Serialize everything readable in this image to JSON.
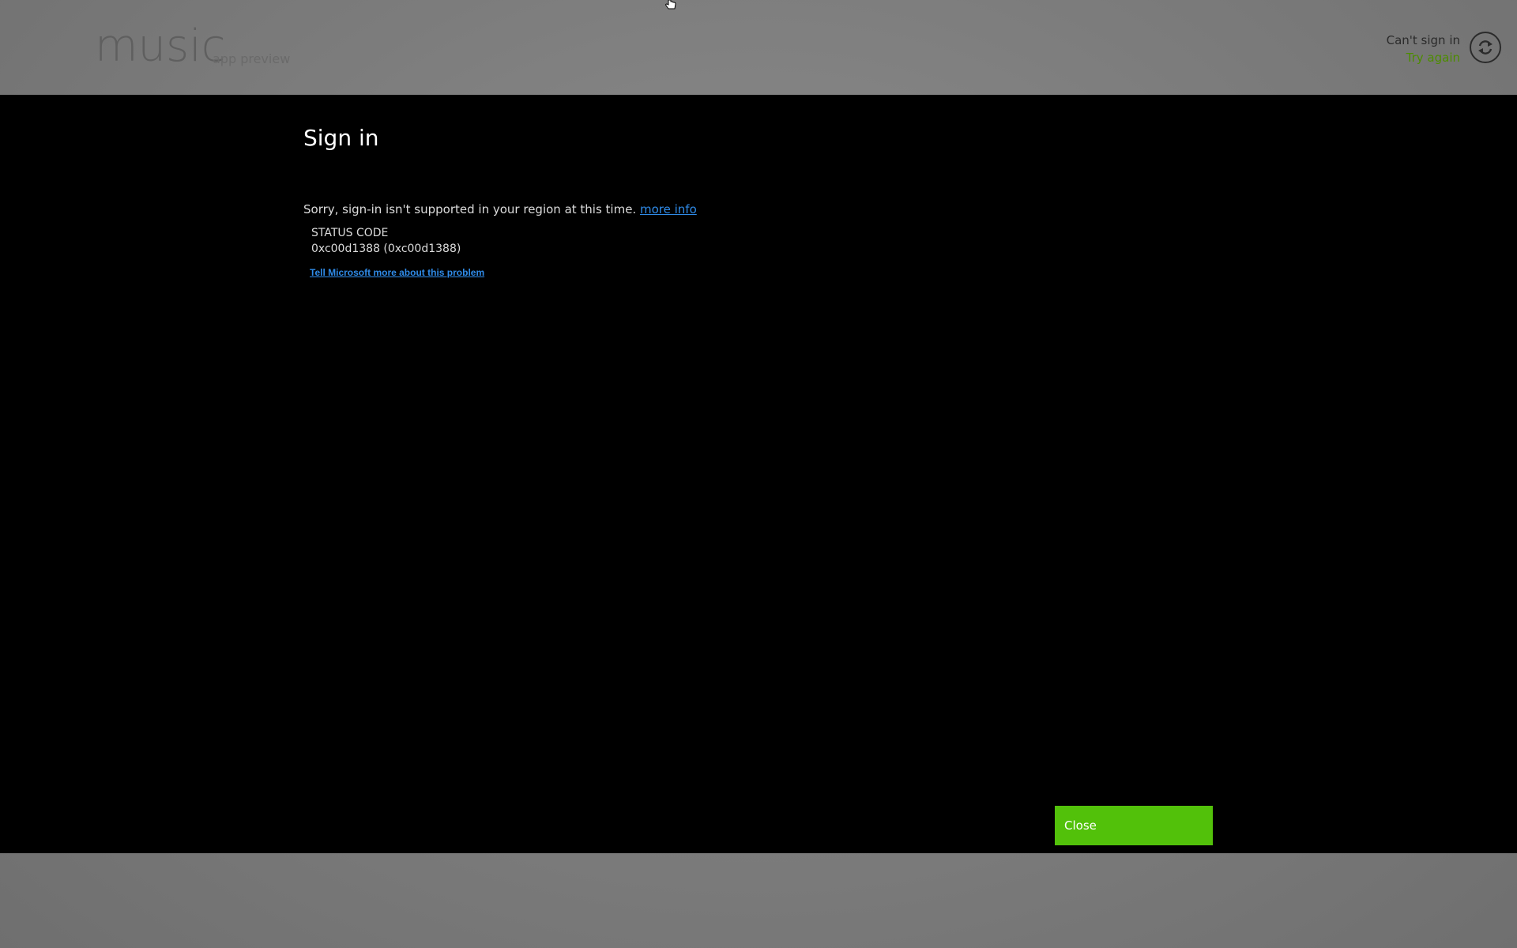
{
  "app": {
    "title": "music",
    "subtitle": "app preview"
  },
  "status": {
    "message": "Can't sign in",
    "action": "Try again",
    "icon": "refresh-icon"
  },
  "dialog": {
    "title": "Sign in",
    "message": "Sorry, sign-in isn't supported in your region at this time.",
    "more_info_link": "more info",
    "status_code_label": "STATUS CODE",
    "status_code_value": "0xc00d1388 (0xc00d1388)",
    "feedback_link": "Tell Microsoft more about this problem",
    "close_label": "Close"
  },
  "colors": {
    "accent_green": "#52c10a",
    "link_blue": "#2f8be8",
    "try_again_green": "#4d8c00"
  }
}
